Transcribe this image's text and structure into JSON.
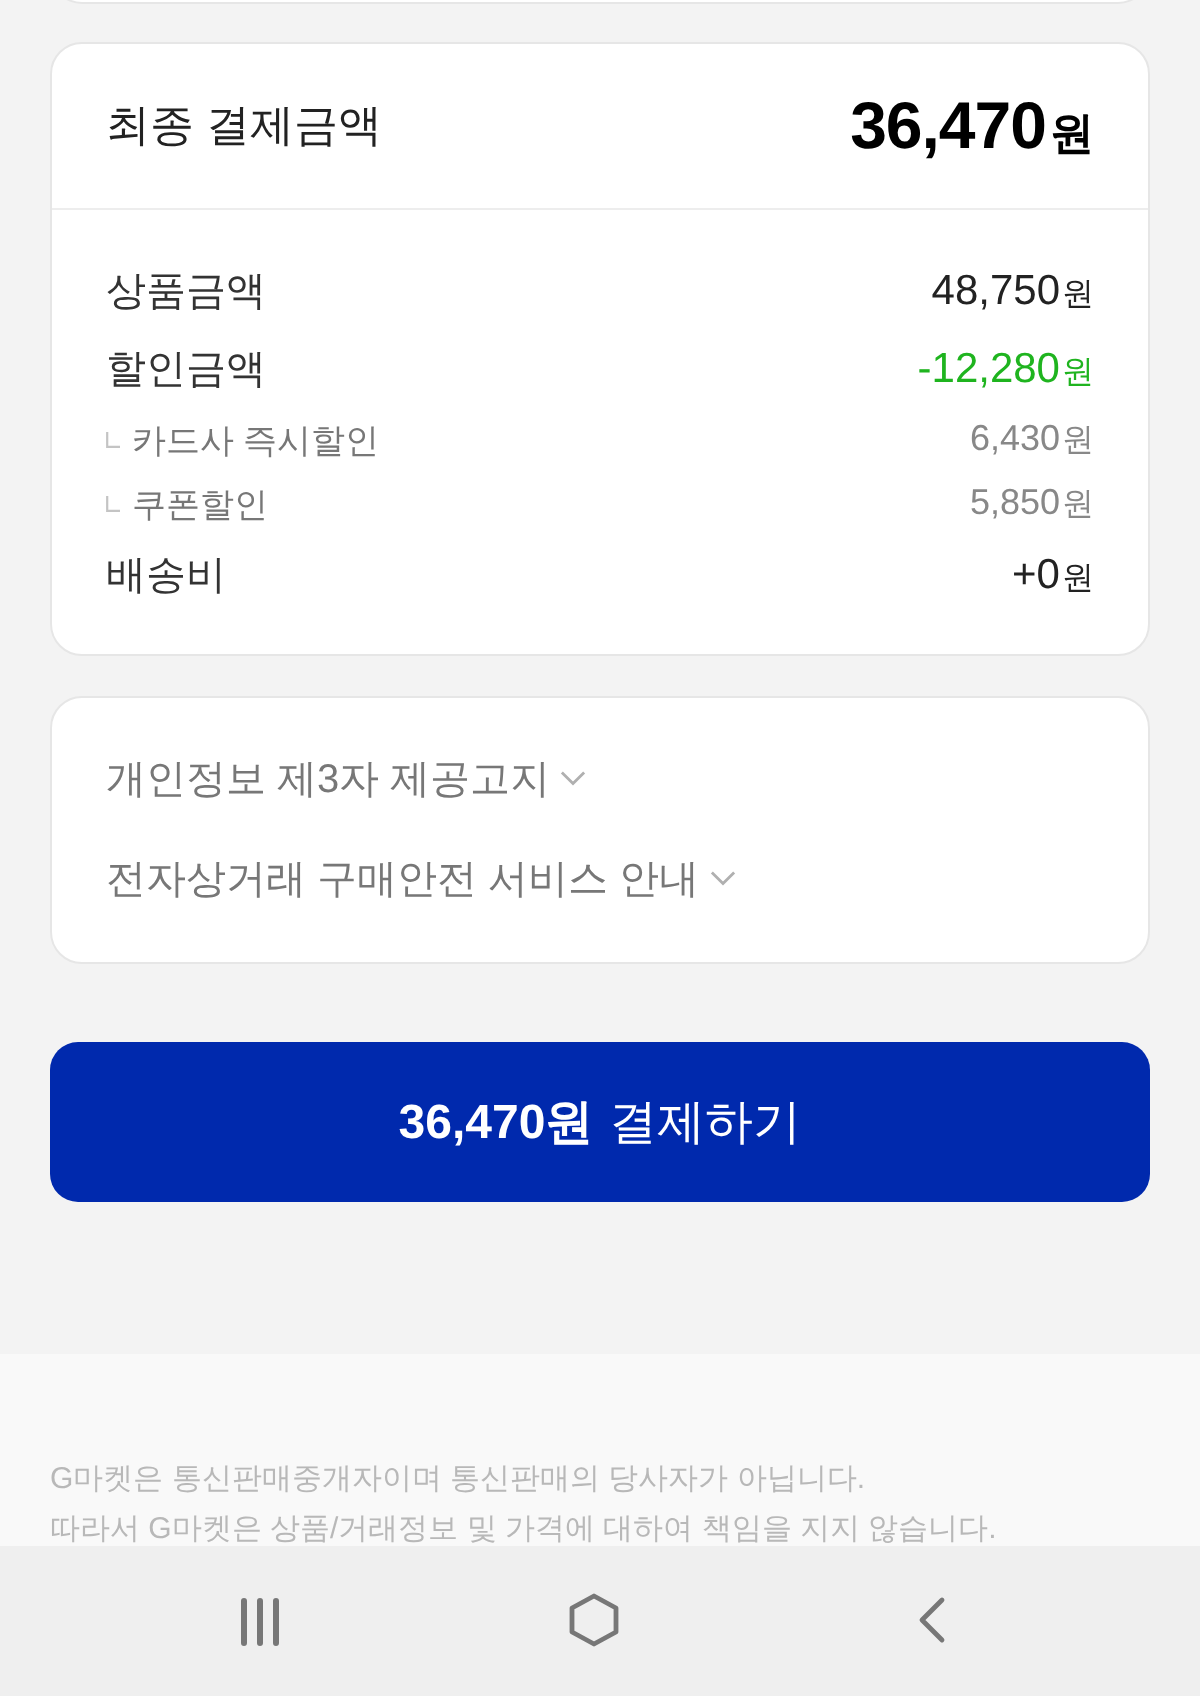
{
  "summary_card": {
    "title": "최종 결제금액",
    "total_amount": "36,470",
    "total_unit": "원"
  },
  "breakdown": [
    {
      "kind": "main",
      "label": "상품금액",
      "amount": "48,750",
      "unit": "원"
    },
    {
      "kind": "discount",
      "label": "할인금액",
      "amount": "-12,280",
      "unit": "원"
    },
    {
      "kind": "sub",
      "label": "카드사 즉시할인",
      "amount": "6,430",
      "unit": "원"
    },
    {
      "kind": "sub",
      "label": "쿠폰할인",
      "amount": "5,850",
      "unit": "원"
    },
    {
      "kind": "main",
      "label": "배송비",
      "amount": "+0",
      "unit": "원"
    }
  ],
  "notices": [
    {
      "label": "개인정보 제3자 제공고지",
      "expanded": false
    },
    {
      "label": "전자상거래 구매안전 서비스 안내",
      "expanded": false
    }
  ],
  "pay_button": {
    "amount": "36,470원",
    "label": "결제하기"
  },
  "disclaimer": [
    "G마켓은 통신판매중개자이며 통신판매의 당사자가 아닙니다.",
    "따라서 G마켓은 상품/거래정보 및 가격에 대하여 책임을 지지 않습니다."
  ]
}
